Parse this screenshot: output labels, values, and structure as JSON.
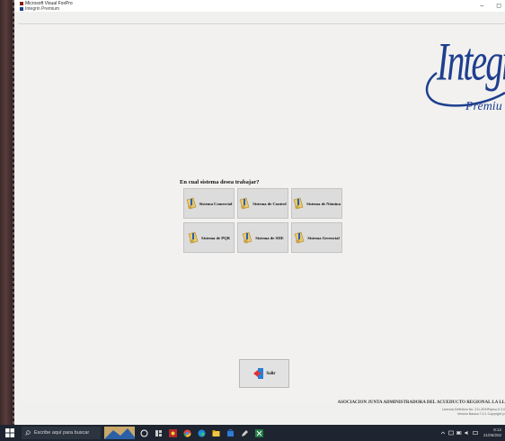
{
  "window": {
    "app_title": "Microsoft Visual FoxPro",
    "doc_title": "Integrin Premium",
    "minimize_glyph": "–",
    "maximize_glyph": "◻"
  },
  "logo": {
    "brand": "Integrin",
    "edition": "Premiu",
    "color": "#1f3f8f"
  },
  "menu": {
    "question": "En cual sistema desea trabajar?",
    "buttons": [
      {
        "label": "Sistema Comercial",
        "icon": "bookmark-folder-icon"
      },
      {
        "label": "Sistema de Control",
        "icon": "bookmark-folder-icon"
      },
      {
        "label": "Sistema de Nómina",
        "icon": "bookmark-folder-icon"
      },
      {
        "label": "Sistema de PQR",
        "icon": "bookmark-folder-icon"
      },
      {
        "label": "Sistema de SIIE",
        "icon": "bookmark-folder-icon"
      },
      {
        "label": "Sistema Gerencial",
        "icon": "bookmark-folder-icon"
      }
    ],
    "exit_label": "Salir",
    "exit_icon": "door-exit-icon"
  },
  "footer": {
    "org": "ASOCIACION JUNTA ADMINISTRADORA DEL ACUEDUCTO REGIONAL LA LL",
    "license": "Licencia Definitiva No. 211-ZDHPqesu-0.3.0",
    "version": "Version Basica 7.0.1 Copyright (c"
  },
  "taskbar": {
    "search_placeholder": "Escribe aquí para buscar",
    "time": "8:12",
    "date": "21/06/202"
  },
  "colors": {
    "accent": "#1f3f8f",
    "button_bg": "#dcdcdc",
    "taskbar_bg": "#1e2530"
  }
}
